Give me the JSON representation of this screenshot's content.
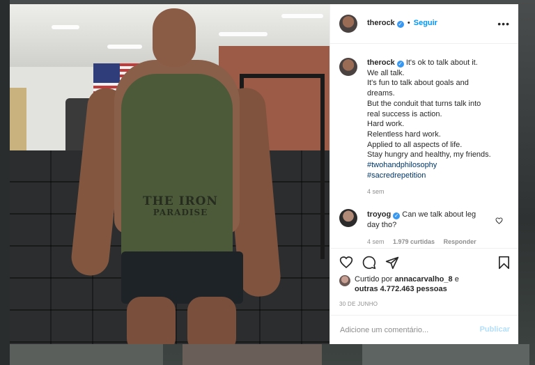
{
  "post": {
    "author": "therock",
    "follow_label": "Seguir",
    "caption_lines": [
      "It's ok to talk about it.",
      "We all talk.",
      "It's fun to talk about goals and",
      "dreams.",
      "But the conduit that turns talk into",
      "real success is action.",
      "Hard work.",
      "Relentless hard work.",
      "Applied to all aspects of life.",
      "Stay hungry and healthy, my friends."
    ],
    "hashtags": [
      "#twohandphilosophy",
      "#sacredrepetition"
    ],
    "caption_time": "4 sem",
    "photo_shirt_text": [
      "THE IRON",
      "PARADISE"
    ]
  },
  "comment": {
    "author": "troyog",
    "text_line1": "Can we talk about leg",
    "text_line2": "day tho?",
    "time": "4 sem",
    "likes": "1.979 curtidas",
    "reply_label": "Responder"
  },
  "likes": {
    "prefix": "Curtido por",
    "user": "annacarvalho_8",
    "connector": "e",
    "others": "outras 4.772.463 pessoas"
  },
  "date": "30 DE JUNHO",
  "add_comment": {
    "placeholder": "Adicione um comentário...",
    "publish_label": "Publicar"
  },
  "colors": {
    "link_blue": "#0095f6",
    "hashtag": "#00376b",
    "muted": "#8e8e8e",
    "verified": "#3897f0"
  },
  "icons": [
    "more-options-icon",
    "verified-badge-icon",
    "heart-icon",
    "comment-icon",
    "share-icon",
    "bookmark-icon",
    "comment-heart-icon"
  ]
}
